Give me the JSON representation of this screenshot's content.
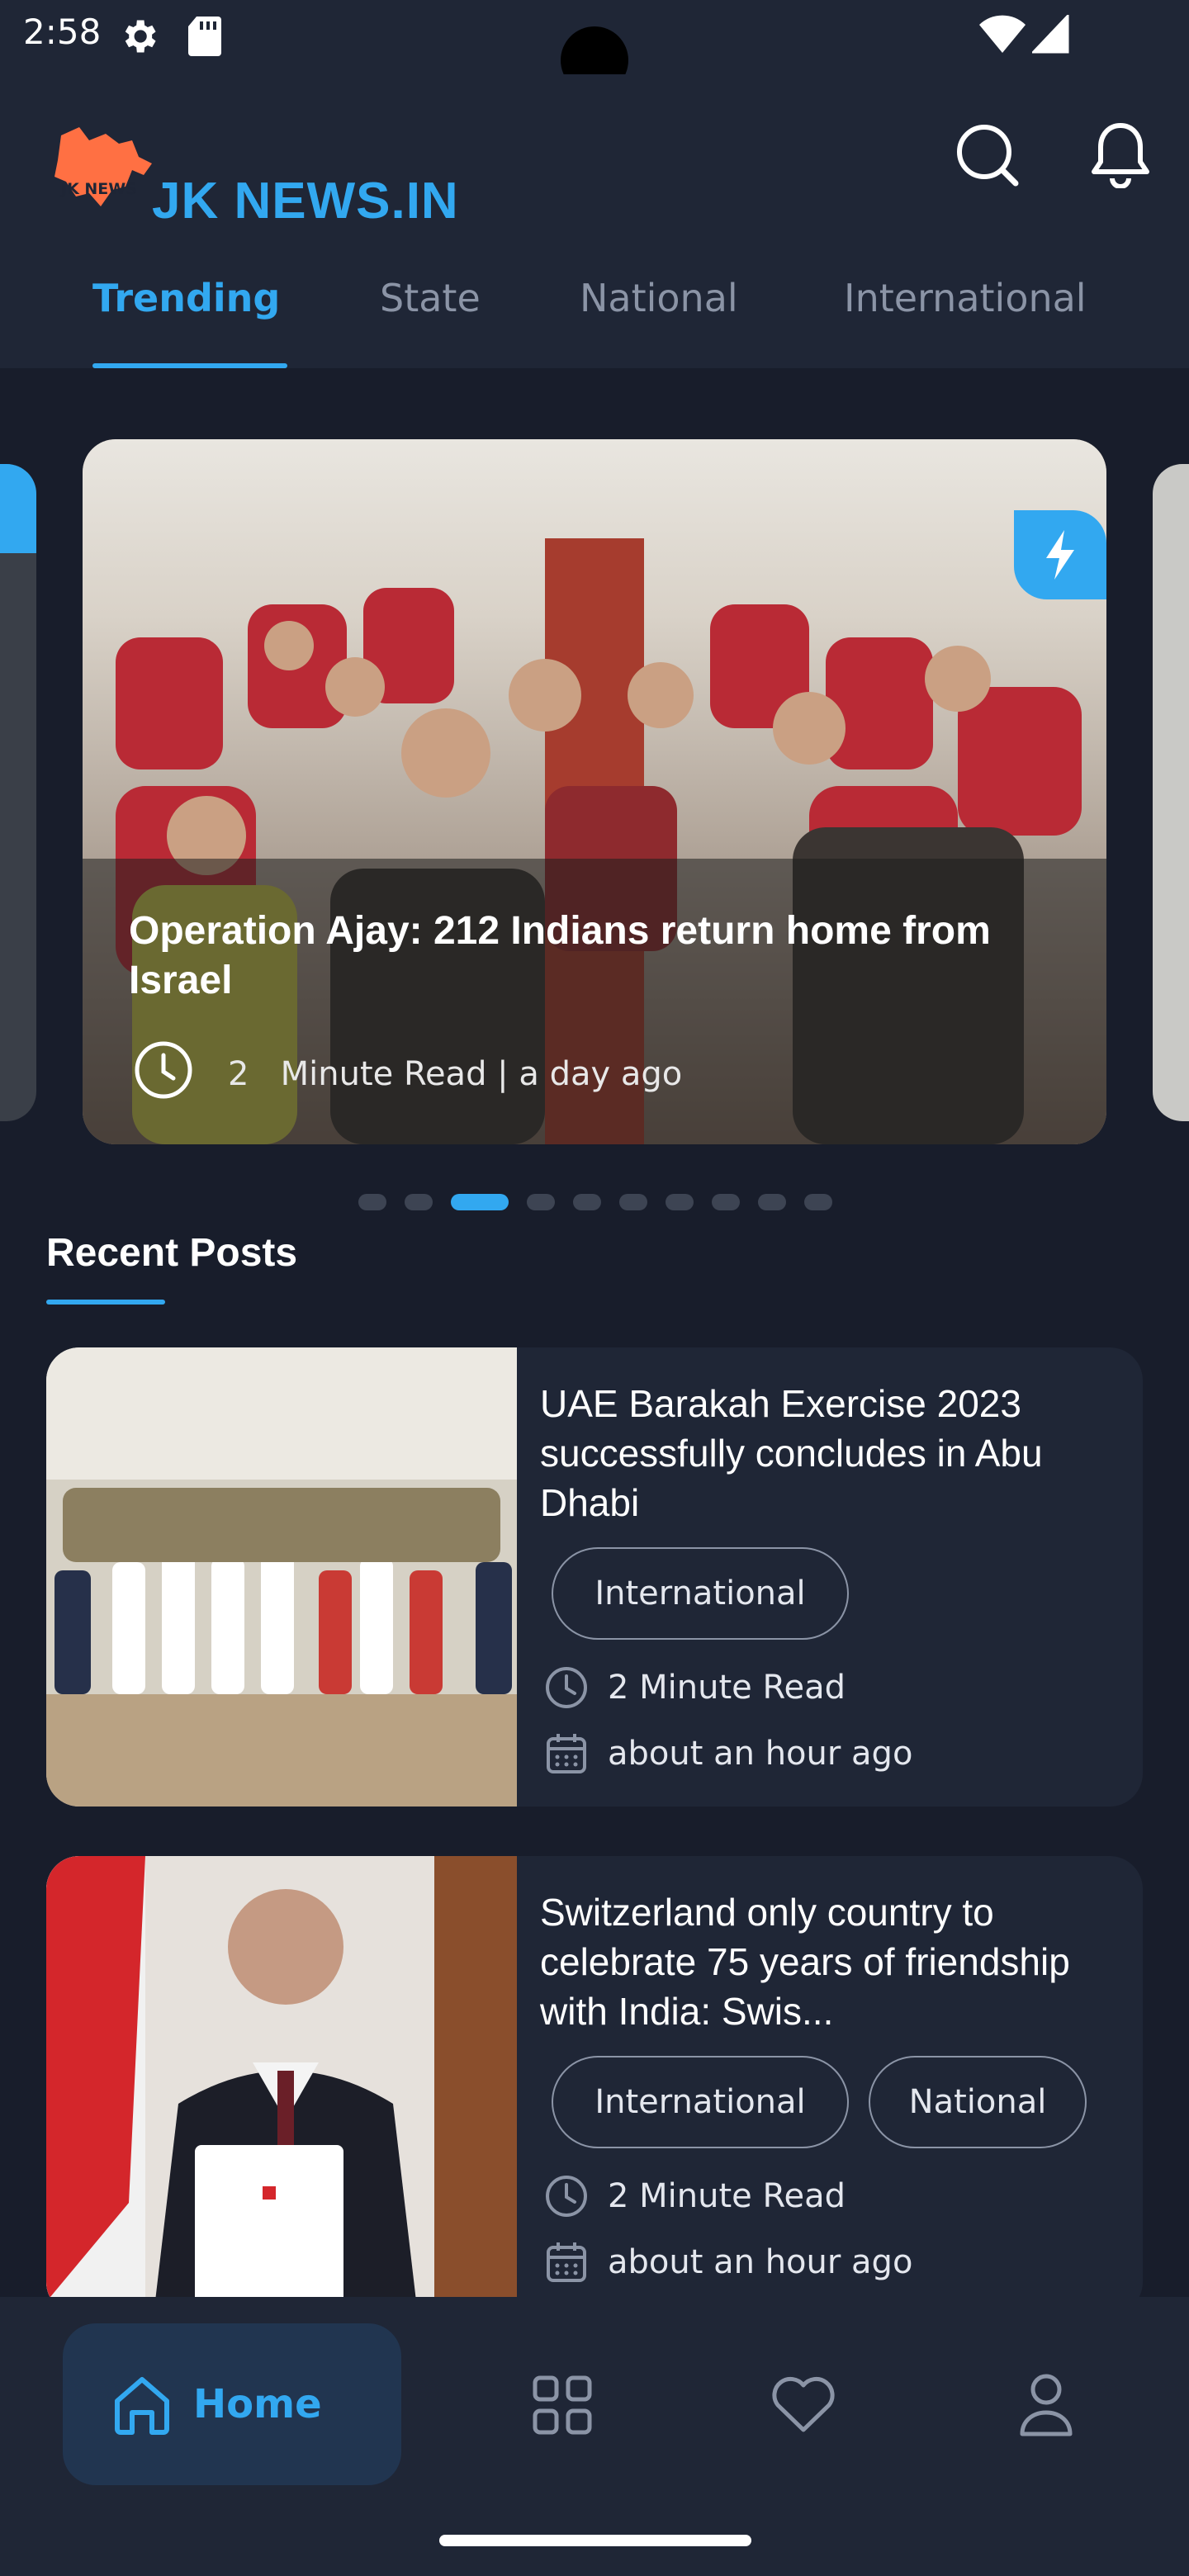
{
  "status_bar": {
    "time": "2:58"
  },
  "app": {
    "logo_badge": "JK NEWS",
    "logo_text": "JK NEWS.IN"
  },
  "tabs": [
    {
      "label": "Trending",
      "active": true
    },
    {
      "label": "State",
      "active": false
    },
    {
      "label": "National",
      "active": false
    },
    {
      "label": "International",
      "active": false
    }
  ],
  "carousel": {
    "title": "Operation Ajay: 212 Indians return home from Israel",
    "read_time": "2",
    "meta_suffix": "Minute Read | a day ago",
    "badge_icon": "lightning-icon",
    "slide_count": 10,
    "active_slide": 3
  },
  "recent": {
    "title": "Recent Posts",
    "posts": [
      {
        "title": "UAE Barakah Exercise 2023 successfully concludes in Abu Dhabi",
        "tags": [
          "International"
        ],
        "read_time": "2 Minute Read",
        "time_ago": "about an hour ago"
      },
      {
        "title": "Switzerland only country to celebrate 75 years of friendship with India: Swis...",
        "tags": [
          "International",
          "National"
        ],
        "read_time": "2 Minute Read",
        "time_ago": "about an hour ago"
      }
    ]
  },
  "bottom_nav": {
    "home_label": "Home",
    "items": [
      "home-icon",
      "grid-icon",
      "heart-icon",
      "profile-icon"
    ]
  },
  "colors": {
    "accent": "#32a8f0",
    "background": "#181d2b",
    "surface": "#1f2636",
    "logo_map": "#ff7043"
  }
}
